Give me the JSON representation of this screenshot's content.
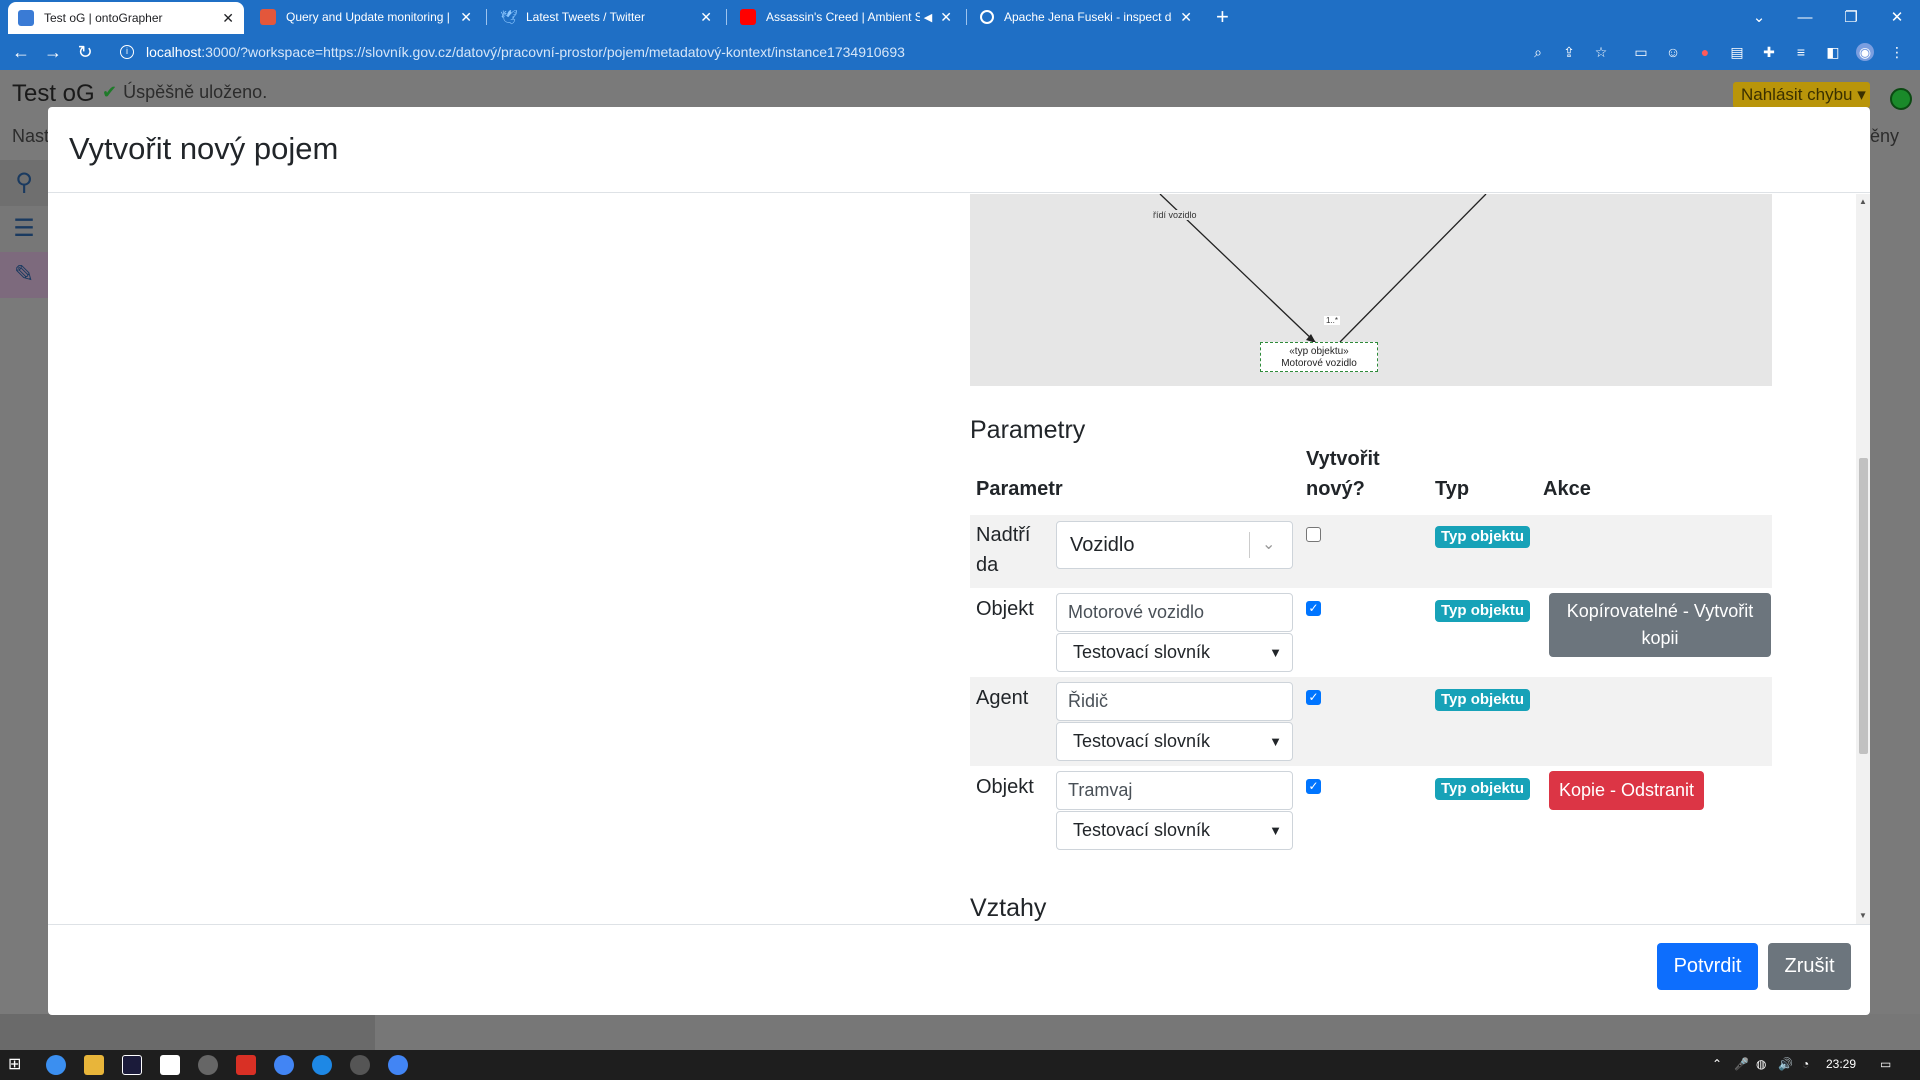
{
  "browser": {
    "tabs": [
      {
        "title": "Test oG | ontoGrapher",
        "active": true
      },
      {
        "title": "Query and Update monitoring | C",
        "active": false
      },
      {
        "title": "Latest Tweets / Twitter",
        "active": false
      },
      {
        "title": "Assassin's Creed | Ambient S",
        "active": false
      },
      {
        "title": "Apache Jena Fuseki - inspect dat",
        "active": false
      }
    ],
    "url_host": "localhost",
    "url_rest": ":3000/?workspace=https://slovník.gov.cz/datový/pracovní-prostor/pojem/metadatový-kontext/instance1734910693"
  },
  "app": {
    "title": "Test oG",
    "saved_text": "Úspěšně uloženo.",
    "nav_text": "Nast",
    "changes_text": "ěny",
    "report_button": "Nahlásit chybu"
  },
  "modal": {
    "title": "Vytvořit nový pojem",
    "diagram": {
      "edge_label": "řídí vozidlo",
      "multiplicity": "1..*",
      "node_stereotype": "«typ objektu»",
      "node_name": "Motorové vozidlo"
    },
    "parameters_title": "Parametry",
    "table_headers": {
      "param": "Parametr",
      "create_line1": "Vytvořit",
      "create_line2": "nový?",
      "type": "Typ",
      "action": "Akce"
    },
    "rows": [
      {
        "label_line1": "Nadtří",
        "label_line2": "da",
        "value": "Vozidlo",
        "checked": false,
        "type": "Typ objektu"
      },
      {
        "label": "Objekt",
        "value": "Motorové vozidlo",
        "vocabulary": "Testovací slovník",
        "checked": true,
        "type": "Typ objektu",
        "action_line1": "Kopírovatelné - Vytvořit",
        "action_line2": "kopii"
      },
      {
        "label": "Agent",
        "value": "Řidič",
        "vocabulary": "Testovací slovník",
        "checked": true,
        "type": "Typ objektu"
      },
      {
        "label": "Objekt",
        "value": "Tramvaj",
        "vocabulary": "Testovací slovník",
        "checked": true,
        "type": "Typ objektu",
        "action": "Kopie - Odstranit"
      }
    ],
    "relations_title": "Vztahy",
    "confirm_button": "Potvrdit",
    "cancel_button": "Zrušit"
  },
  "taskbar": {
    "time": "23:29"
  }
}
